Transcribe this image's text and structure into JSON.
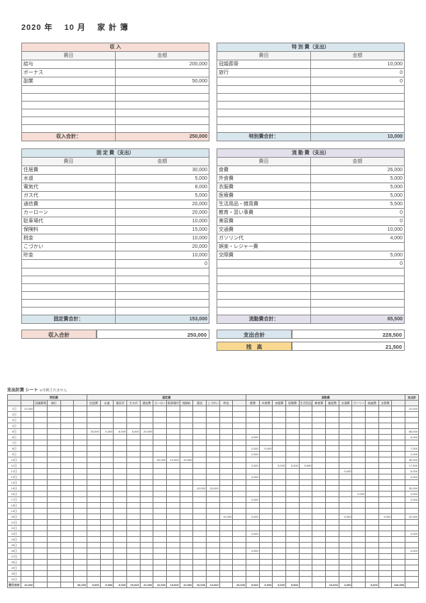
{
  "title_parts": {
    "year": "2020 年",
    "month": "10 月",
    "label": "家 計 簿"
  },
  "income": {
    "section": "収 入",
    "cols": {
      "a": "費目",
      "b": "金額"
    },
    "rows": [
      {
        "a": "給与",
        "b": "200,000"
      },
      {
        "a": "ボーナス",
        "b": ""
      },
      {
        "a": "副業",
        "b": "50,000"
      },
      {
        "a": "",
        "b": ""
      },
      {
        "a": "",
        "b": ""
      },
      {
        "a": "",
        "b": ""
      },
      {
        "a": "",
        "b": ""
      },
      {
        "a": "",
        "b": ""
      },
      {
        "a": "",
        "b": ""
      }
    ],
    "sum_label": "収入合計：",
    "sum": "250,000"
  },
  "special": {
    "section": "特 別 費（支出）",
    "cols": {
      "a": "費目",
      "b": "金額"
    },
    "rows": [
      {
        "a": "冠婚葬祭",
        "b": "10,000"
      },
      {
        "a": "旅行",
        "b": "0"
      },
      {
        "a": "",
        "b": "0"
      },
      {
        "a": "",
        "b": ""
      },
      {
        "a": "",
        "b": ""
      },
      {
        "a": "",
        "b": ""
      },
      {
        "a": "",
        "b": ""
      },
      {
        "a": "",
        "b": ""
      },
      {
        "a": "",
        "b": ""
      }
    ],
    "sum_label": "特別費合計：",
    "sum": "10,000"
  },
  "fixed": {
    "section": "固 定 費（支出）",
    "cols": {
      "a": "費目",
      "b": "金額"
    },
    "rows": [
      {
        "a": "住居費",
        "b": "30,000"
      },
      {
        "a": "水道",
        "b": "5,000"
      },
      {
        "a": "電気代",
        "b": "8,000"
      },
      {
        "a": "ガス代",
        "b": "5,000"
      },
      {
        "a": "通信費",
        "b": "20,000"
      },
      {
        "a": "カーローン",
        "b": "20,000"
      },
      {
        "a": "駐車場代",
        "b": "10,000"
      },
      {
        "a": "保険料",
        "b": "15,000"
      },
      {
        "a": "税金",
        "b": "10,000"
      },
      {
        "a": "こづかい",
        "b": "20,000"
      },
      {
        "a": "貯金",
        "b": "10,000"
      },
      {
        "a": "",
        "b": "0"
      },
      {
        "a": "",
        "b": ""
      },
      {
        "a": "",
        "b": ""
      },
      {
        "a": "",
        "b": ""
      },
      {
        "a": "",
        "b": ""
      },
      {
        "a": "",
        "b": ""
      },
      {
        "a": "",
        "b": ""
      }
    ],
    "sum_label": "固定費合計：",
    "sum": "153,000"
  },
  "variable": {
    "section": "流 動 費（支出）",
    "cols": {
      "a": "費目",
      "b": "金額"
    },
    "rows": [
      {
        "a": "食費",
        "b": "26,000"
      },
      {
        "a": "外食費",
        "b": "5,000"
      },
      {
        "a": "衣服費",
        "b": "5,000"
      },
      {
        "a": "医療費",
        "b": "5,000"
      },
      {
        "a": "生活用品・雑貨費",
        "b": "5,500"
      },
      {
        "a": "教育・習い事費",
        "b": "0"
      },
      {
        "a": "美容費",
        "b": "0"
      },
      {
        "a": "交通費",
        "b": "10,000"
      },
      {
        "a": "ガソリン代",
        "b": "4,000"
      },
      {
        "a": "娯楽・レジャー費",
        "b": ""
      },
      {
        "a": "交際費",
        "b": "5,000"
      },
      {
        "a": "",
        "b": "0"
      },
      {
        "a": "",
        "b": ""
      },
      {
        "a": "",
        "b": ""
      },
      {
        "a": "",
        "b": ""
      },
      {
        "a": "",
        "b": ""
      },
      {
        "a": "",
        "b": ""
      },
      {
        "a": "",
        "b": ""
      }
    ],
    "sum_label": "流動費合計：",
    "sum": "65,500"
  },
  "bottom": {
    "income_total_label": "収入合計",
    "income_total": "250,000",
    "expense_total_label": "支出合計",
    "expense_total": "228,500",
    "balance_label": "残　高",
    "balance": "21,500"
  },
  "daily": {
    "title": "支出計算 シート",
    "note": "※印刷されません",
    "groups": [
      "特別費",
      "固定費",
      "流動費",
      "支出計"
    ],
    "cols": [
      "",
      "冠婚葬祭",
      "旅行",
      "",
      "",
      "住居費",
      "水道",
      "電気代",
      "ガス代",
      "通信費",
      "カーローン",
      "駐車場代",
      "保険料",
      "税金",
      "こづかい",
      "貯金",
      "",
      "食費",
      "外食費",
      "衣服費",
      "医療費",
      "生活用品",
      "教育費",
      "美容費",
      "交通費",
      "ガソリン",
      "娯楽費",
      "交際費",
      "",
      ""
    ],
    "group_spans": [
      5,
      12,
      12,
      1
    ],
    "dates": [
      "1日",
      "2日",
      "3日",
      "4日",
      "5日",
      "6日",
      "7日",
      "8日",
      "9日",
      "10日",
      "11日",
      "12日",
      "13日",
      "14日",
      "15日",
      "16日",
      "17日",
      "18日",
      "19日",
      "20日",
      "21日",
      "22日",
      "23日",
      "24日",
      "25日",
      "26日",
      "27日",
      "28日",
      "29日",
      "30日",
      "31日"
    ],
    "cells": {
      "0": {
        "0": "10,000",
        "29": "10,000"
      },
      "4": {
        "5": "30,000",
        "6": "5,000",
        "7": "8,000",
        "8": "5,000",
        "9": "20,000",
        "29": "68,000"
      },
      "5": {
        "17": "4,000",
        "29": "4,000"
      },
      "7": {
        "17": "2,000",
        "18": "5,000",
        "29": "7,000"
      },
      "8": {
        "17": "2,000",
        "29": "2,000"
      },
      "9": {
        "10": "20,000",
        "11": "10,000",
        "12": "15,000",
        "29": "45,000"
      },
      "10": {
        "17": "2,000",
        "19": "5,000",
        "20": "5,000",
        "21": "5,500",
        "29": "17,500"
      },
      "11": {
        "24": "5,000",
        "29": "5,000"
      },
      "12": {
        "17": "4,000",
        "29": "4,000"
      },
      "14": {
        "13": "10,000",
        "14": "20,000",
        "29": "30,000"
      },
      "15": {
        "25": "4,000",
        "29": "4,000"
      },
      "16": {
        "17": "2,000",
        "29": "2,000"
      },
      "19": {
        "15": "10,000",
        "17": "2,000",
        "24": "5,000",
        "27": "5,000",
        "29": "22,000"
      },
      "22": {
        "17": "4,000",
        "29": "4,000"
      },
      "25": {
        "17": "4,000",
        "29": "4,000"
      }
    },
    "sum_row_label": "費目合計",
    "sum_row": [
      "10,000",
      "",
      "",
      "",
      "30,000",
      "5,000",
      "8,000",
      "5,000",
      "20,000",
      "20,000",
      "10,000",
      "15,000",
      "10,000",
      "20,000",
      "10,000",
      "",
      "26,000",
      "5,000",
      "5,000",
      "5,000",
      "5,500",
      "",
      "",
      "10,000",
      "4,000",
      "",
      "5,000",
      "",
      "228,500"
    ]
  }
}
